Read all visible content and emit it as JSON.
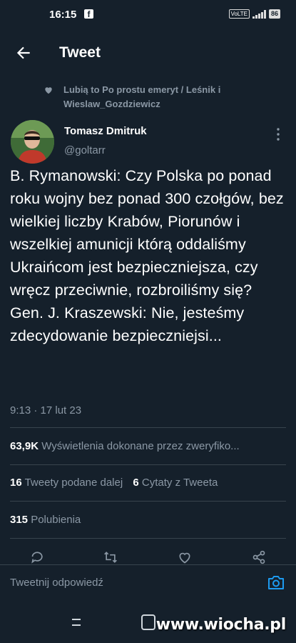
{
  "status": {
    "time": "16:15",
    "battery": "86",
    "volte": "VoLTE"
  },
  "header": {
    "title": "Tweet"
  },
  "liked_by": "Lubią to Po prostu emeryt / Leśnik i Wieslaw_Gozdziewicz",
  "author": {
    "name": "Tomasz Dmitruk",
    "handle": "@goltarr"
  },
  "tweet": {
    "text": "B. Rymanowski: Czy Polska po ponad roku wojny bez ponad 300 czołgów, bez wielkiej liczby Krabów, Piorunów i wszelkiej amunicji którą oddaliśmy Ukraińcom jest bezpieczniejsza, czy wręcz przeciwnie, rozbroiliśmy się?\nGen. J. Kraszewski: Nie, jesteśmy zdecydowanie bezpieczniejsi...",
    "time": "9:13 · 17 lut 23"
  },
  "stats": {
    "views_count": "63,9K",
    "views_label": "Wyświetlenia dokonane przez zweryfiko...",
    "retweets_count": "16",
    "retweets_label": "Tweety podane dalej",
    "quotes_count": "6",
    "quotes_label": "Cytaty z Tweeta",
    "likes_count": "315",
    "likes_label": "Polubienia"
  },
  "reply": {
    "placeholder": "Tweetnij odpowiedź"
  },
  "watermark": "www.wiocha.pl",
  "colors": {
    "background": "#15202b",
    "secondary_text": "#8b98a5",
    "accent": "#1d9bf0",
    "divider": "#38444d"
  }
}
